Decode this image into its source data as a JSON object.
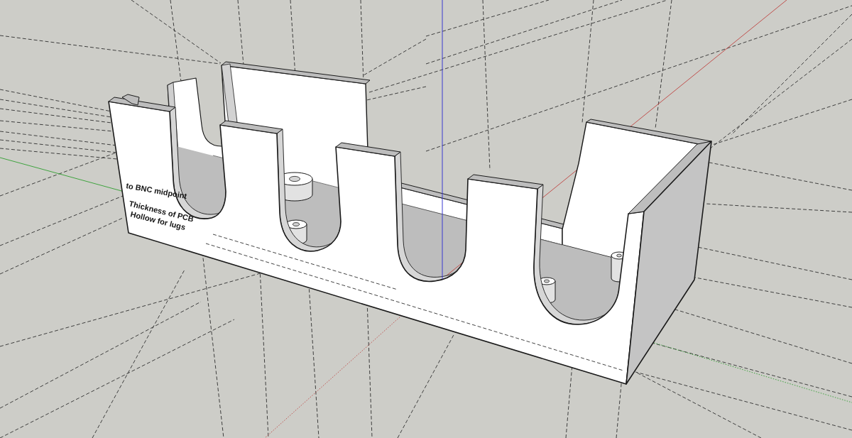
{
  "viewport": {
    "labels": [
      "to BNC midpoint",
      "Thickness of PCB",
      "Hollow for lugs"
    ]
  }
}
